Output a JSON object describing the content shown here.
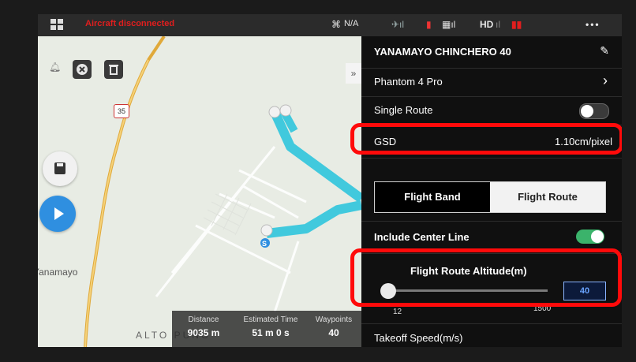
{
  "topbar": {
    "warning_text": "Aircraft disconnected",
    "drone_status": "N/A",
    "hd_label": "HD",
    "more_label": "•••"
  },
  "map": {
    "town_label": "Yanamayo",
    "place_label": "ALTO PUNO",
    "road_shield": "35",
    "stats": {
      "distance_label": "Distance",
      "distance_value": "9035 m",
      "time_label": "Estimated Time",
      "time_value": "51 m 0 s",
      "waypoints_label": "Waypoints",
      "waypoints_value": "40"
    }
  },
  "panel": {
    "mission_title": "YANAMAYO CHINCHERO 40",
    "aircraft": "Phantom 4 Pro",
    "single_route_label": "Single Route",
    "single_route_on": false,
    "gsd_label": "GSD",
    "gsd_value": "1.10cm/pixel",
    "segment": {
      "left": "Flight Band",
      "right": "Flight Route",
      "active": "left"
    },
    "center_line_label": "Include Center Line",
    "center_line_on": true,
    "altitude_label": "Flight Route Altitude(m)",
    "altitude_min": "12",
    "altitude_max": "1500",
    "altitude_value": "40",
    "takeoff_label": "Takeoff Speed(m/s)"
  },
  "colors": {
    "route": "#41c9dd",
    "toggle_on": "#3bb36b",
    "highlight": "#ff0a0a",
    "accent_blue": "#2f8fe0"
  }
}
